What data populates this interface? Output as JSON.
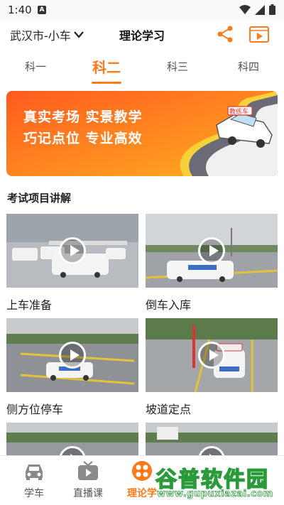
{
  "status_bar": {
    "time": "1:40",
    "notif": "A"
  },
  "header": {
    "city": "武汉市-小车",
    "title": "理论学习"
  },
  "tabs": [
    {
      "label": "科一",
      "active": false
    },
    {
      "label": "科二",
      "active": true
    },
    {
      "label": "科三",
      "active": false
    },
    {
      "label": "科四",
      "active": false
    }
  ],
  "banner": {
    "line1": "真实考场  实景教学",
    "line2": "巧记点位  专业高效",
    "car_text": "教练车"
  },
  "section": {
    "title": "考试项目讲解"
  },
  "videos": [
    {
      "label": "上车准备"
    },
    {
      "label": "倒车入库"
    },
    {
      "label": "侧方位停车"
    },
    {
      "label": "坡道定点"
    },
    {
      "label": ""
    },
    {
      "label": ""
    }
  ],
  "bottom_nav": [
    {
      "label": "学车",
      "icon": "car-icon",
      "active": false
    },
    {
      "label": "直播课",
      "icon": "tv-icon",
      "active": false
    },
    {
      "label": "理论学",
      "icon": "grid-icon",
      "active": true
    }
  ],
  "watermark": {
    "text": "谷普软件园",
    "url": "www.gupuxiazai.com"
  },
  "colors": {
    "accent": "#ff7a1a",
    "banner_start": "#ff5a1f",
    "banner_end": "#ffb020"
  }
}
